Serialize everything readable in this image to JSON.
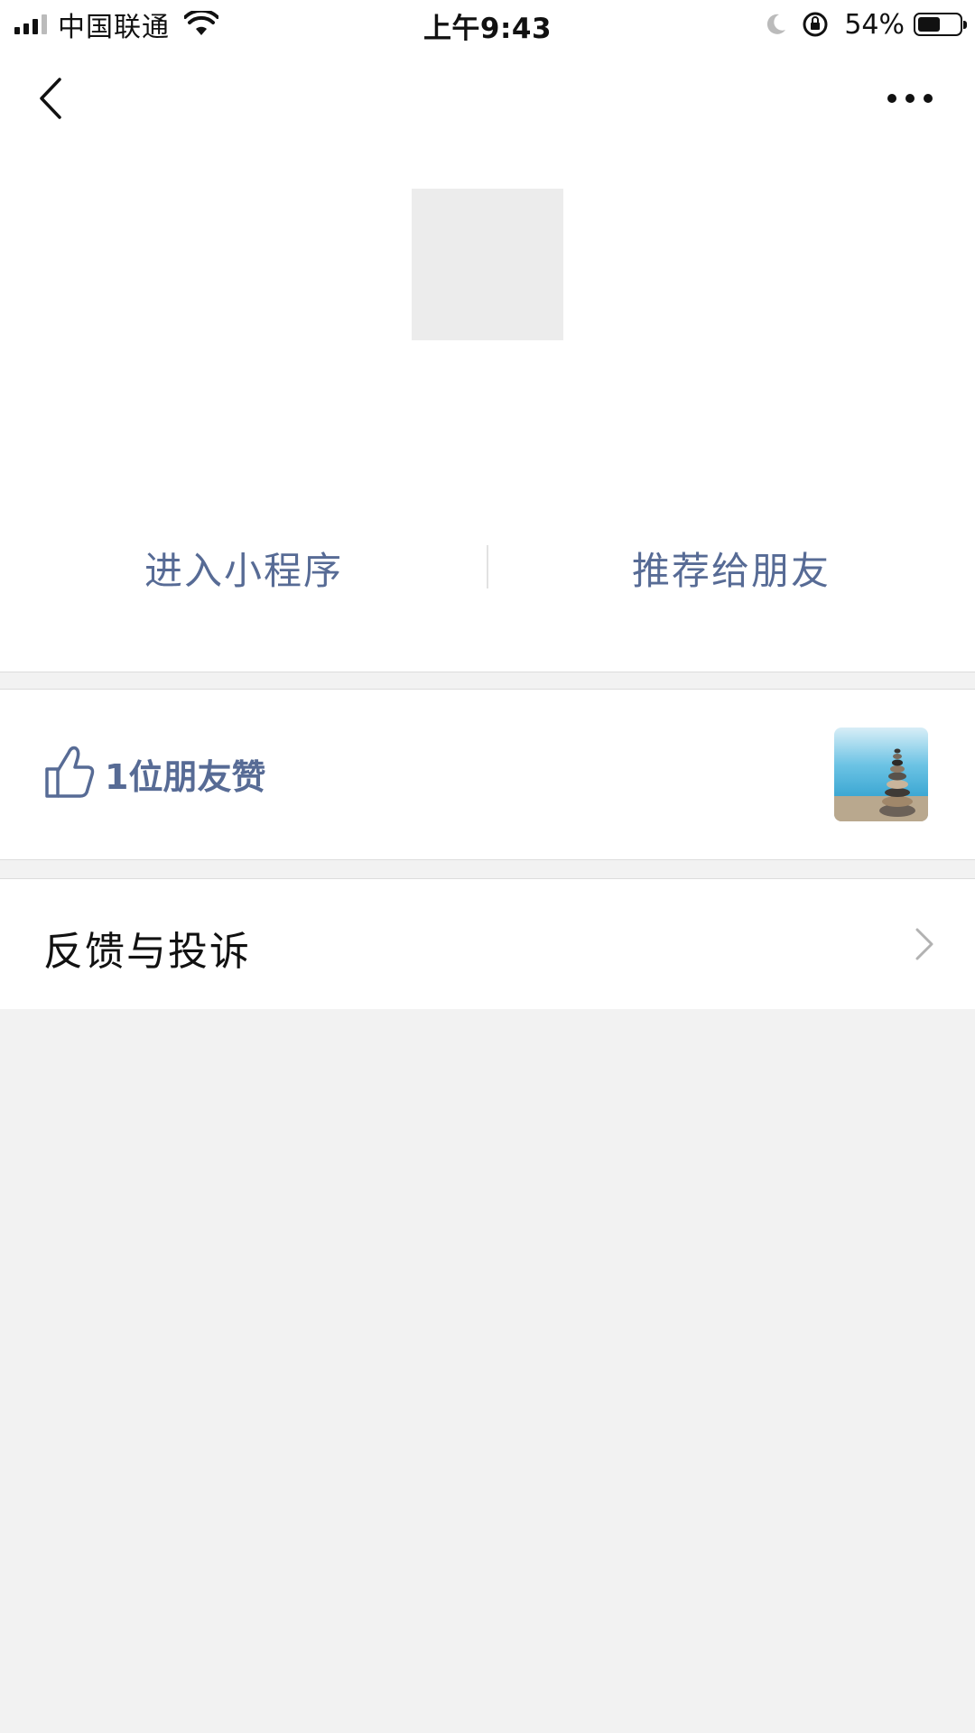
{
  "status_bar": {
    "carrier": "中国联通",
    "time": "上午9:43",
    "battery_percent": "54%",
    "battery_level": 0.54
  },
  "nav": {
    "back_icon": "chevron-left-icon",
    "more_icon": "ellipsis-icon"
  },
  "header": {
    "enter_label": "进入小程序",
    "recommend_label": "推荐给朋友"
  },
  "likes": {
    "text": "1位朋友赞",
    "icon": "thumbs-up-icon"
  },
  "feedback": {
    "label": "反馈与投诉",
    "icon": "chevron-right-icon"
  },
  "colors": {
    "link": "#576b95",
    "background": "#f2f2f2"
  }
}
